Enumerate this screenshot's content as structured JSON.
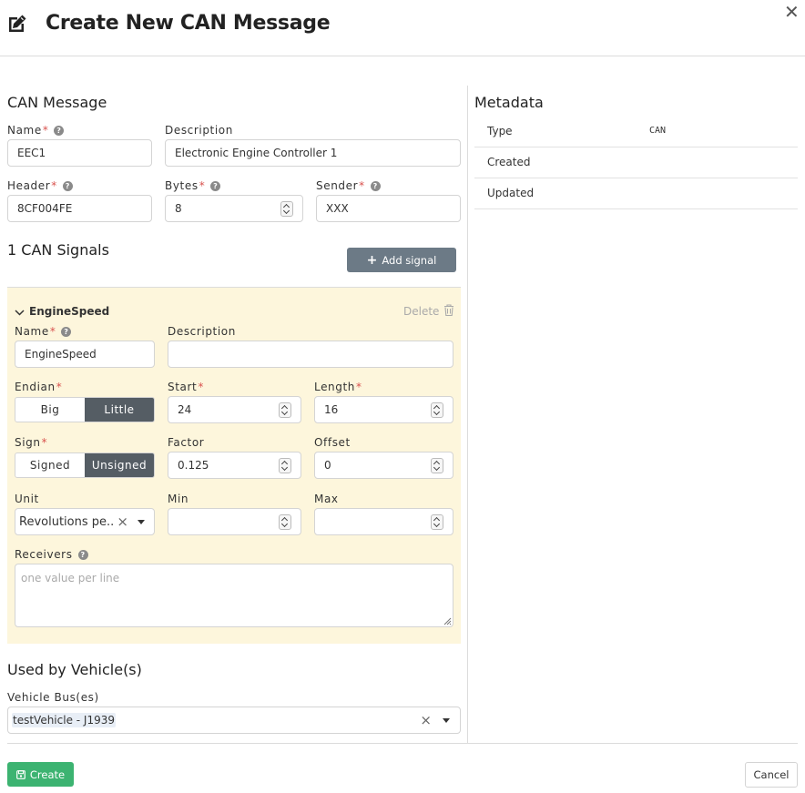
{
  "dialog": {
    "title": "Create New CAN Message",
    "close_glyph": "✕"
  },
  "message": {
    "heading": "CAN Message",
    "name_label": "Name",
    "name_value": "EEC1",
    "description_label": "Description",
    "description_value": "Electronic Engine Controller 1",
    "header_label": "Header",
    "header_value": "8CF004FE",
    "bytes_label": "Bytes",
    "bytes_value": "8",
    "sender_label": "Sender",
    "sender_value": "XXX",
    "required_mark": "*",
    "help_glyph": "?"
  },
  "signals": {
    "heading": "1 CAN Signals",
    "add_label": "Add signal",
    "add_glyph": "+",
    "items": [
      {
        "title": "EngineSpeed",
        "delete_label": "Delete",
        "name_label": "Name",
        "name_value": "EngineSpeed",
        "description_label": "Description",
        "description_value": "",
        "endian_label": "Endian",
        "endian_options": [
          "Big",
          "Little"
        ],
        "endian_selected": "Little",
        "start_label": "Start",
        "start_value": "24",
        "length_label": "Length",
        "length_value": "16",
        "sign_label": "Sign",
        "sign_options": [
          "Signed",
          "Unsigned"
        ],
        "sign_selected": "Unsigned",
        "factor_label": "Factor",
        "factor_value": "0.125",
        "offset_label": "Offset",
        "offset_value": "0",
        "unit_label": "Unit",
        "unit_value": "Revolutions pe...",
        "min_label": "Min",
        "min_value": "",
        "max_label": "Max",
        "max_value": "",
        "receivers_label": "Receivers",
        "receivers_placeholder": "one value per line"
      }
    ]
  },
  "vehicles": {
    "heading": "Used by Vehicle(s)",
    "bus_label": "Vehicle Bus(es)",
    "bus_selected": "testVehicle - J1939",
    "clear_glyph": "×"
  },
  "metadata": {
    "heading": "Metadata",
    "rows": [
      {
        "key": "Type",
        "value": "CAN"
      },
      {
        "key": "Created",
        "value": ""
      },
      {
        "key": "Updated",
        "value": ""
      }
    ]
  },
  "footer": {
    "create_label": "Create",
    "cancel_label": "Cancel"
  },
  "colors": {
    "create": "#3cb371",
    "add_signal": "#6c7a86",
    "signal_panel": "#fdf6dc",
    "segment_selected": "#555d64",
    "required": "#d9534f"
  },
  "icons": [
    "edit-icon",
    "close-icon",
    "plus-icon",
    "chevron-down-icon",
    "trash-icon",
    "help-icon",
    "save-icon",
    "dropdown-caret-icon",
    "clear-icon",
    "resize-handle-icon"
  ]
}
